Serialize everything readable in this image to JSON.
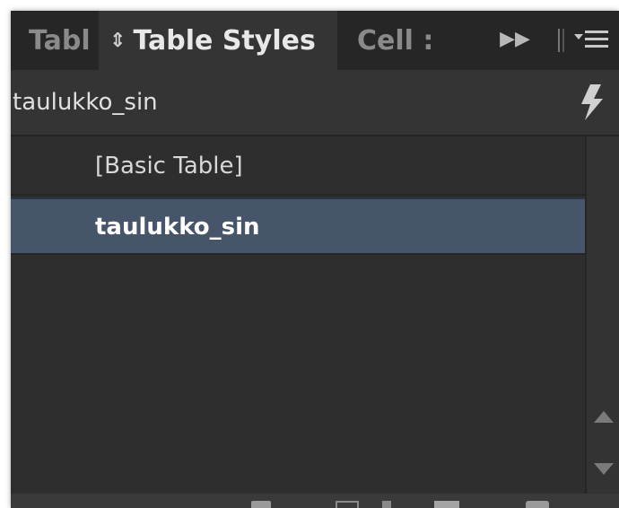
{
  "tabs": [
    {
      "label": "Tabl",
      "active": false
    },
    {
      "label": "Table Styles",
      "active": true
    },
    {
      "label": "Cell :",
      "active": false
    }
  ],
  "tab_active_icon": "up-down-arrows-icon",
  "current_style": {
    "name": "taulukko_sin"
  },
  "styles": [
    {
      "label": "[Basic Table]",
      "selected": false
    },
    {
      "label": "taulukko_sin",
      "selected": true
    }
  ],
  "toolbar_icons": [
    "style-group-icon",
    "clear-overrides-icon",
    "new-style-icon",
    "delete-style-icon"
  ],
  "colors": {
    "panel_bg": "#343434",
    "tabbar_bg": "#262626",
    "selected_row": "#46556a",
    "text": "#d8d8d8"
  }
}
